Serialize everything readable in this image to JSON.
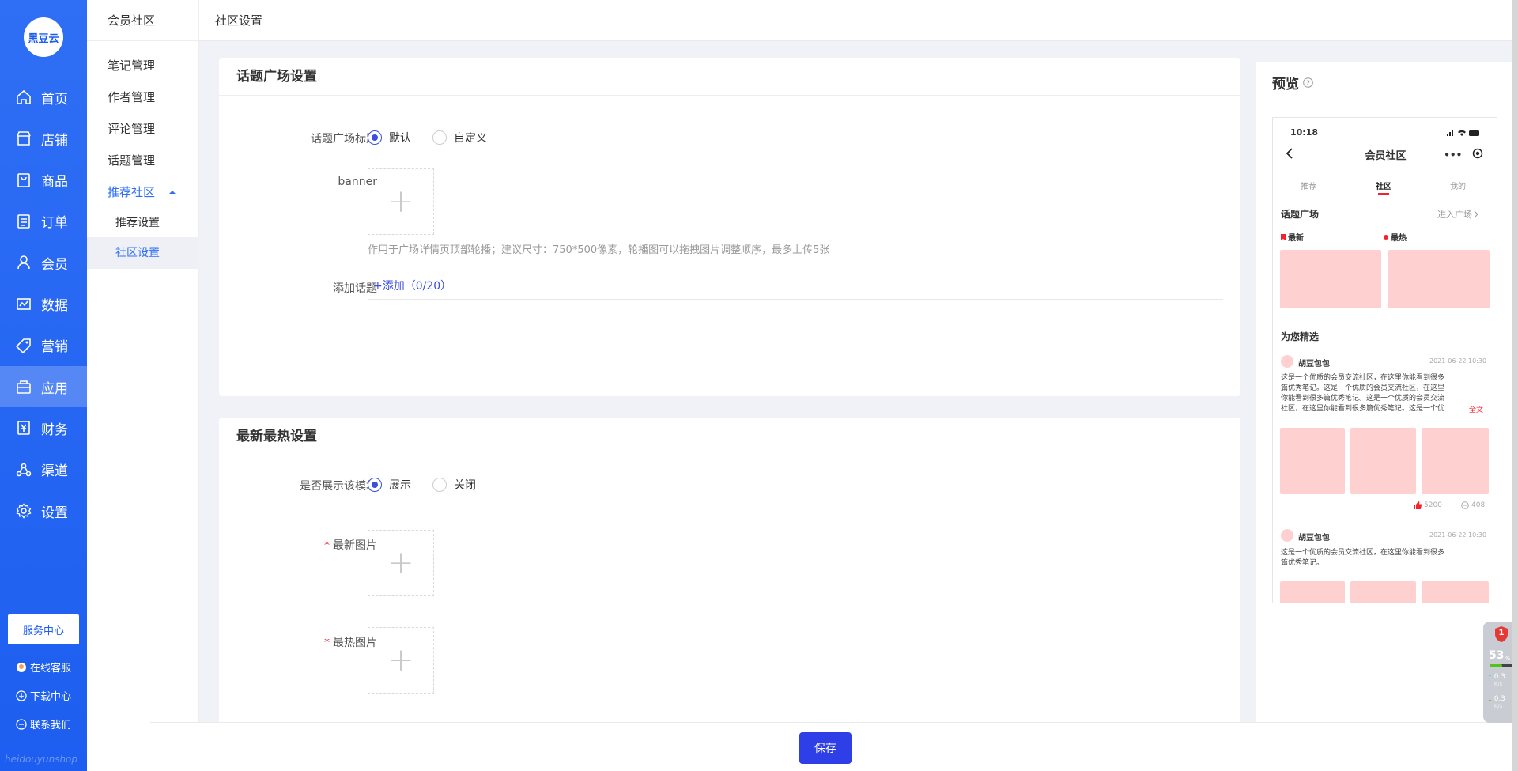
{
  "logo": {
    "text": "黑豆云"
  },
  "nav": {
    "items": [
      {
        "label": "首页",
        "icon": "home-icon"
      },
      {
        "label": "店铺",
        "icon": "store-icon"
      },
      {
        "label": "商品",
        "icon": "goods-icon"
      },
      {
        "label": "订单",
        "icon": "order-icon"
      },
      {
        "label": "会员",
        "icon": "member-icon"
      },
      {
        "label": "数据",
        "icon": "chart-icon"
      },
      {
        "label": "营销",
        "icon": "tag-icon"
      },
      {
        "label": "应用",
        "icon": "app-icon"
      },
      {
        "label": "财务",
        "icon": "finance-icon"
      },
      {
        "label": "渠道",
        "icon": "channel-icon"
      },
      {
        "label": "设置",
        "icon": "gear-icon"
      }
    ],
    "active_index": 7,
    "service_center": "服务中心",
    "online_service": "在线客服",
    "download_center": "下载中心",
    "contact_us": "联系我们",
    "watermark": "heidouyunshop"
  },
  "submenu": {
    "title": "会员社区",
    "items": [
      "笔记管理",
      "作者管理",
      "评论管理",
      "话题管理"
    ],
    "group": "推荐社区",
    "children": [
      "推荐设置",
      "社区设置"
    ]
  },
  "breadcrumb": "社区设置",
  "topic_card": {
    "title": "话题广场设置",
    "title_label": "话题广场标题",
    "opt_default": "默认",
    "opt_custom": "自定义",
    "banner_label": "banner",
    "banner_hint": "作用于广场详情页顶部轮播；建议尺寸：750*500像素，轮播图可以拖拽图片调整顺序，最多上传5张",
    "add_topic_label": "添加话题",
    "add_topic_link": "+添加（0/20）"
  },
  "hot_card": {
    "title": "最新最热设置",
    "show_label": "是否展示该模块",
    "opt_show": "展示",
    "opt_hide": "关闭",
    "latest_label": "最新图片",
    "hottest_label": "最热图片",
    "required_mark": "*"
  },
  "preview": {
    "title": "预览",
    "time": "10:18",
    "page_title": "会员社区",
    "tabs": [
      "推荐",
      "社区",
      "我的"
    ],
    "plaza": "话题广场",
    "enter": "进入广场",
    "latest": "最新",
    "hottest": "最热",
    "picks": "为您精选",
    "post1": {
      "author": "胡豆包包",
      "date": "2021-06-22 10:30",
      "text": "这是一个优质的会员交流社区，在这里你能看到很多篇优秀笔记。这是一个优质的会员交流社区，在这里你能看到很多篇优秀笔记。这是一个优质的会员交流社区，在这里你能看到很多篇优秀笔记。这是一个优质的会员交流社区...",
      "full": "全文",
      "likes": "5200",
      "comments": "408"
    },
    "post2": {
      "author": "胡豆包包",
      "date": "2021-06-22 10:30",
      "text": "这是一个优质的会员交流社区，在这里你能看到很多篇优秀笔记。"
    }
  },
  "save_button": "保存",
  "widget": {
    "badge": "1",
    "percent": "53",
    "percent_unit": "%",
    "up": "0.3",
    "up_unit": "K/s",
    "down": "0.3",
    "down_unit": "K/s"
  }
}
